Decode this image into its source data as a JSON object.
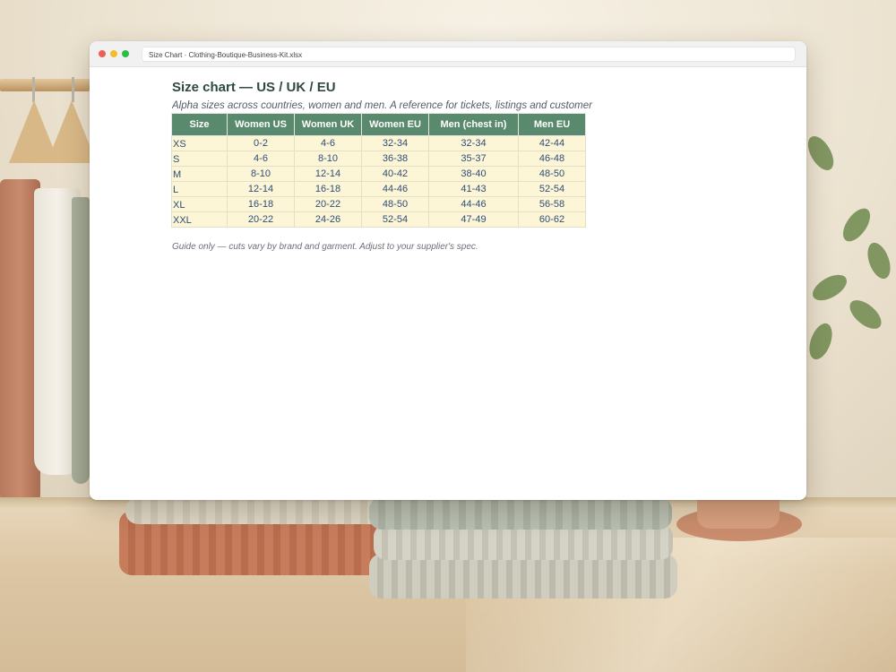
{
  "window": {
    "title": "Size Chart · Clothing-Boutique-Business-Kit.xlsx"
  },
  "sheet": {
    "title": "Size chart — US / UK / EU",
    "subtitle": "Alpha sizes across countries, women and men. A reference for tickets, listings and customer",
    "footnote": "Guide only — cuts vary by brand and garment. Adjust to your supplier's spec."
  },
  "table": {
    "headers": [
      "Size",
      "Women US",
      "Women UK",
      "Women EU",
      "Men (chest in)",
      "Men EU"
    ],
    "rows": [
      [
        "XS",
        "0-2",
        "4-6",
        "32-34",
        "32-34",
        "42-44"
      ],
      [
        "S",
        "4-6",
        "8-10",
        "36-38",
        "35-37",
        "46-48"
      ],
      [
        "M",
        "8-10",
        "12-14",
        "40-42",
        "38-40",
        "48-50"
      ],
      [
        "L",
        "12-14",
        "16-18",
        "44-46",
        "41-43",
        "52-54"
      ],
      [
        "XL",
        "16-18",
        "20-22",
        "48-50",
        "44-46",
        "56-58"
      ],
      [
        "XXL",
        "20-22",
        "24-26",
        "52-54",
        "47-49",
        "60-62"
      ]
    ]
  },
  "colors": {
    "header_bg": "#5a8a6e",
    "cell_bg": "#fdf6d6",
    "cell_text": "#2d4d78",
    "title_text": "#2e4a3c"
  }
}
